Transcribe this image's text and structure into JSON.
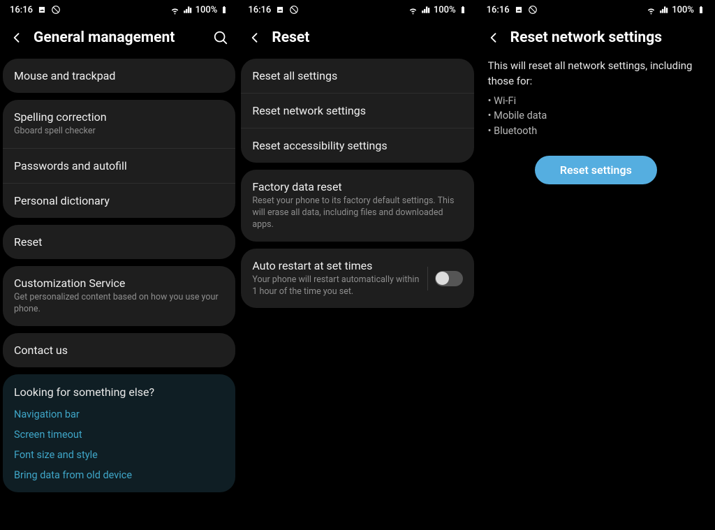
{
  "status": {
    "time": "16:16",
    "battery": "100%"
  },
  "screen1": {
    "title": "General management",
    "rows": {
      "mouse": "Mouse and trackpad",
      "spell_title": "Spelling correction",
      "spell_sub": "Gboard spell checker",
      "passwords": "Passwords and autofill",
      "dictionary": "Personal dictionary",
      "reset": "Reset",
      "cust_title": "Customization Service",
      "cust_sub": "Get personalized content based on how you use your phone.",
      "contact": "Contact us"
    },
    "looking": {
      "title": "Looking for something else?",
      "links": [
        "Navigation bar",
        "Screen timeout",
        "Font size and style",
        "Bring data from old device"
      ]
    }
  },
  "screen2": {
    "title": "Reset",
    "rows": {
      "reset_all": "Reset all settings",
      "reset_net": "Reset network settings",
      "reset_acc": "Reset accessibility settings",
      "factory_title": "Factory data reset",
      "factory_sub": "Reset your phone to its factory default settings. This will erase all data, including files and downloaded apps.",
      "auto_title": "Auto restart at set times",
      "auto_sub": "Your phone will restart automatically within 1 hour of the time you set."
    }
  },
  "screen3": {
    "title": "Reset network settings",
    "body": "This will reset all network settings, including those for:",
    "bullets": [
      "Wi-Fi",
      "Mobile data",
      "Bluetooth"
    ],
    "button": "Reset settings"
  }
}
